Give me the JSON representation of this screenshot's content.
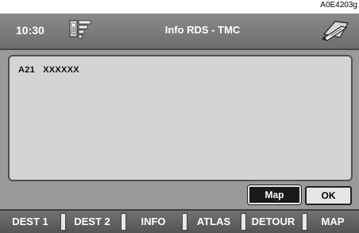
{
  "reference_code": "A0E4203g",
  "titlebar": {
    "time": "10:30",
    "title": "Info RDS - TMC"
  },
  "panel": {
    "road": "A21",
    "message": "XXXXXX"
  },
  "buttons": {
    "map": "Map",
    "ok": "OK"
  },
  "menu": [
    {
      "label": "DEST 1"
    },
    {
      "label": "DEST 2"
    },
    {
      "label": "INFO"
    },
    {
      "label": "ATLAS"
    },
    {
      "label": "DETOUR"
    },
    {
      "label": "MAP"
    }
  ],
  "colors": {
    "screen": "#9a9a9a",
    "titlebar": "#777777",
    "panel": "#d4d4d4"
  }
}
